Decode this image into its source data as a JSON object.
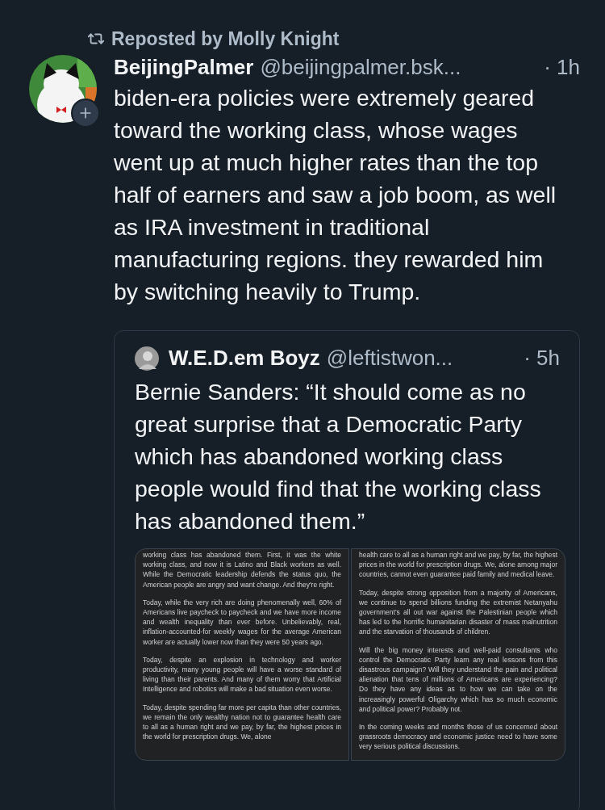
{
  "repost": {
    "label": "Reposted by Molly Knight"
  },
  "post": {
    "author": {
      "name": "BeijingPalmer",
      "handle": "@beijingpalmer.bsk...",
      "time": "· 1h"
    },
    "text": "biden-era policies were extremely geared toward the working class, whose wages went up at much higher rates than the top half of earners and saw a job boom, as well as IRA investment in traditional manufacturing regions. they rewarded him by switching heavily to Trump.",
    "quote": {
      "author": {
        "name": "W.E.D.em Boyz",
        "handle": "@leftistwon...",
        "time": "· 5h"
      },
      "text": "Bernie Sanders: “It should come as no great surprise that a Democratic Party which has abandoned working class people would find that the working class has abandoned them.”",
      "images": [
        {
          "paragraphs": [
            "working class has abandoned them. First, it was the white working class, and now it is Latino and Black workers as well. While the Democratic leadership defends the status quo, the American people are angry and want change. And they're right.",
            "Today, while the very rich are doing phenomenally well, 60% of Americans live paycheck to paycheck and we have more income and wealth inequality than ever before. Unbelievably, real, inflation-accounted-for weekly wages for the average American worker are actually lower now than they were 50 years ago.",
            "Today, despite an explosion in technology and worker productivity, many young people will have a worse standard of living than their parents. And many of them worry that Artificial Intelligence and robotics will make a bad situation even worse.",
            "Today, despite spending far more per capita than other countries, we remain the only wealthy nation not to guarantee health care to all as a human right and we pay, by far, the highest prices in the world for prescription drugs. We, alone"
          ]
        },
        {
          "paragraphs": [
            "health care to all as a human right and we pay, by far, the highest prices in the world for prescription drugs. We, alone among major countries, cannot even guarantee paid family and medical leave.",
            "Today, despite strong opposition from a majority of Americans, we continue to spend billions funding the extremist Netanyahu government's all out war against the Palestinian people which has led to the horrific humanitarian disaster of mass malnutrition and the starvation of thousands of children.",
            "Will the big money interests and well-paid consultants who control the Democratic Party learn any real lessons from this disastrous campaign? Will they understand the pain and political alienation that tens of millions of Americans are experiencing? Do they have any ideas as to how we can take on the increasingly powerful Oligarchy which has so much economic and political power? Probably not.",
            "In the coming weeks and months those of us concerned about grassroots democracy and economic justice need to have some very serious political discussions."
          ]
        }
      ]
    }
  }
}
